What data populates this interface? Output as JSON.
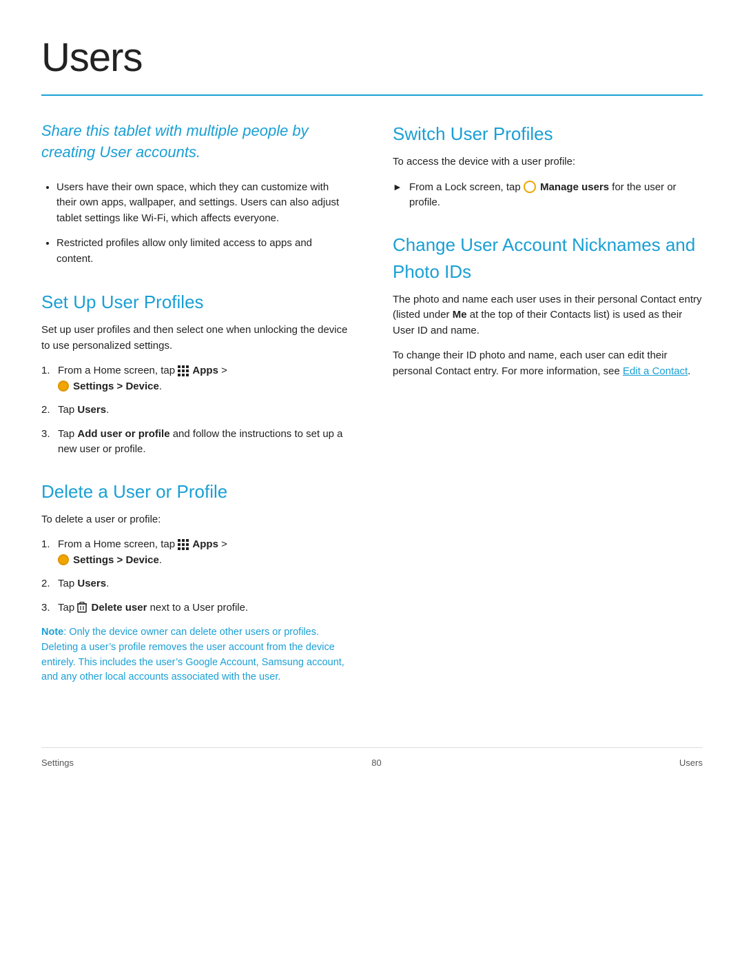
{
  "page": {
    "title": "Users",
    "footer_left": "Settings",
    "footer_center": "80",
    "footer_right": "Users"
  },
  "intro": {
    "text": "Share this tablet with multiple people by creating User accounts."
  },
  "bullets": [
    "Users have their own space, which they can customize with their own apps, wallpaper, and settings. Users can also adjust tablet settings like Wi-Fi, which affects everyone.",
    "Restricted profiles allow only limited access to apps and content."
  ],
  "set_up_section": {
    "title": "Set Up User Profiles",
    "intro": "Set up user profiles and then select one when unlocking the device to use personalized settings.",
    "steps": [
      {
        "id": 1,
        "text_parts": [
          "From a Home screen, tap ",
          "Apps",
          " > ",
          "Settings > Device",
          "."
        ],
        "has_apps_icon": true,
        "has_settings_icon": true
      },
      {
        "id": 2,
        "text_parts": [
          "Tap ",
          "Users",
          "."
        ],
        "bold_word": "Users"
      },
      {
        "id": 3,
        "text_parts": [
          "Tap ",
          "Add user or profile",
          " and follow the instructions to set up a new user or profile."
        ],
        "bold_word": "Add user or profile"
      }
    ]
  },
  "delete_section": {
    "title": "Delete a User or Profile",
    "intro": "To delete a user or profile:",
    "steps": [
      {
        "id": 1,
        "text_parts": [
          "From a Home screen, tap ",
          "Apps",
          " > ",
          "Settings > Device",
          "."
        ],
        "has_apps_icon": true,
        "has_settings_icon": true
      },
      {
        "id": 2,
        "text_parts": [
          "Tap ",
          "Users",
          "."
        ],
        "bold_word": "Users"
      },
      {
        "id": 3,
        "text_parts": [
          "Tap ",
          "Delete user",
          " next to a User profile."
        ],
        "has_trash_icon": true,
        "bold_word": "Delete user"
      }
    ],
    "note_label": "Note",
    "note_text": ": Only the device owner can delete other users or profiles. Deleting a user’s profile removes the user account from the device entirely. This includes the user’s Google Account, Samsung account, and any other local accounts associated with the user."
  },
  "switch_section": {
    "title": "Switch User Profiles",
    "intro": "To access the device with a user profile:",
    "step_text_parts": [
      "From a Lock screen, tap ",
      "Manage users",
      " for the user or profile."
    ],
    "bold_word": "Manage users"
  },
  "change_section": {
    "title": "Change User Account Nicknames and Photo IDs",
    "para1": "The photo and name each user uses in their personal Contact entry (listed under ",
    "para1_bold": "Me",
    "para1_end": " at the top of their Contacts list) is used as their User ID and name.",
    "para2_start": "To change their ID photo and name, each user can edit their personal Contact entry. For more information, see ",
    "para2_link": "Edit a Contact",
    "para2_end": "."
  }
}
